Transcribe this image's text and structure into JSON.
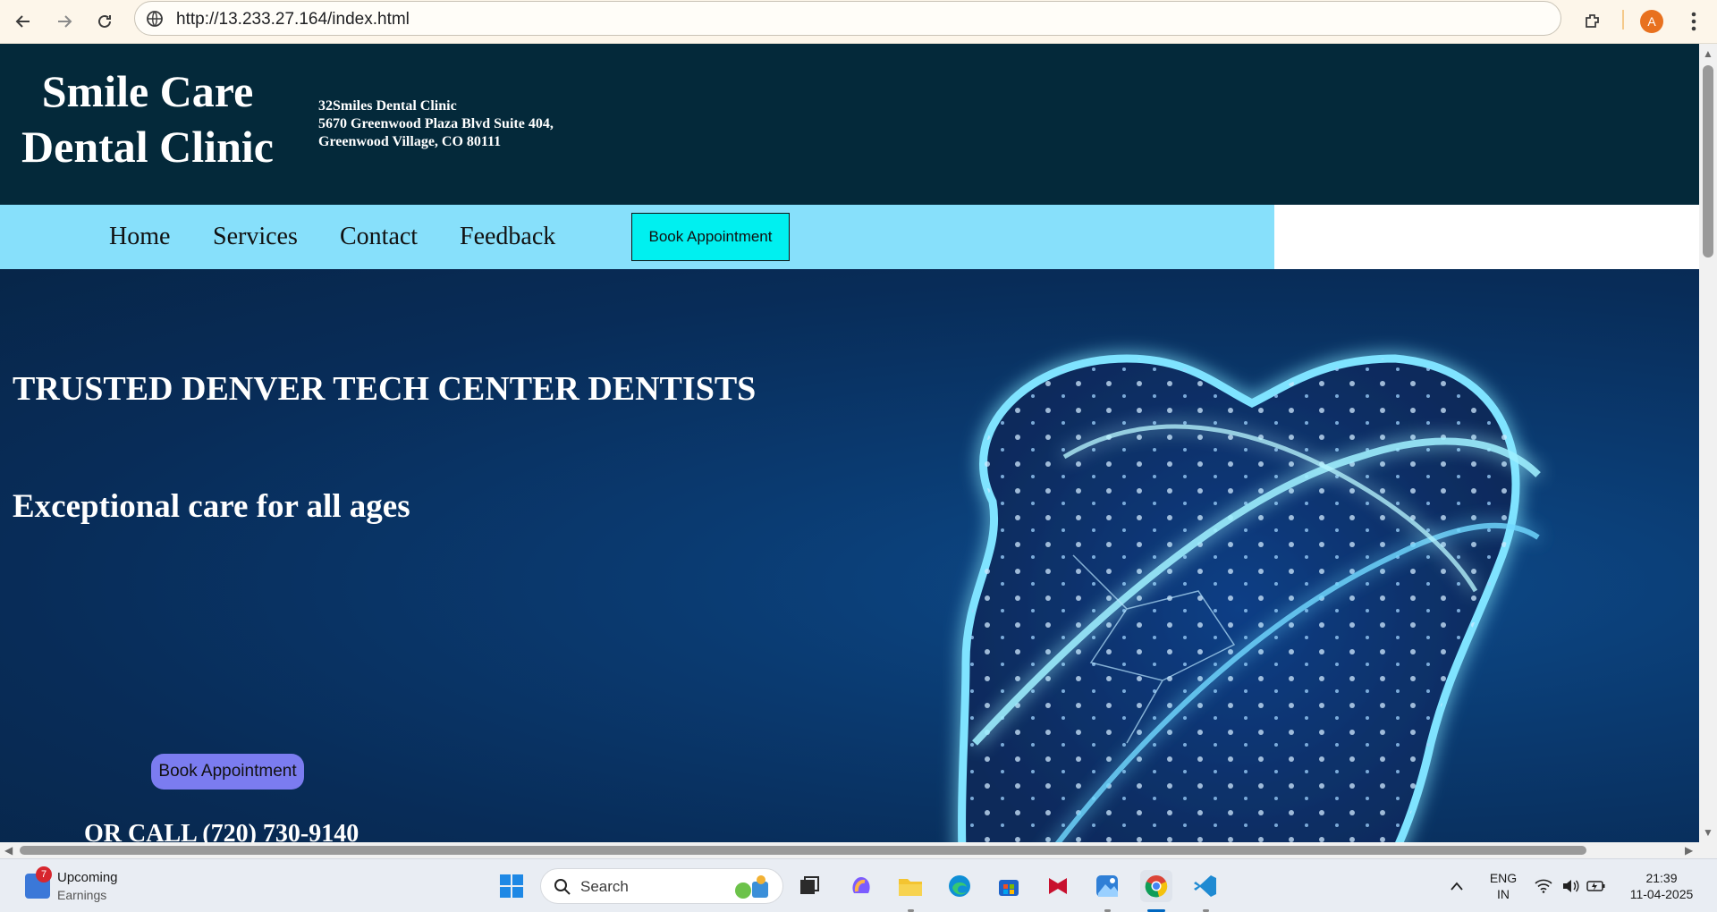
{
  "browser": {
    "url": "http://13.233.27.164/index.html",
    "profile_initial": "A",
    "icons": [
      "back-arrow-icon",
      "forward-arrow-icon",
      "reload-icon",
      "site-info-icon",
      "extensions-icon",
      "profile-avatar",
      "more-menu-icon"
    ]
  },
  "site": {
    "logo": "Smile Care Dental Clinic",
    "address": {
      "line1": "32Smiles Dental Clinic",
      "line2": "5670 Greenwood Plaza Blvd Suite 404,",
      "line3": "Greenwood Village, CO 80111"
    },
    "nav": {
      "items": [
        "Home",
        "Services",
        "Contact",
        "Feedback"
      ],
      "book_label": "Book Appointment"
    },
    "hero": {
      "title": "TRUSTED DENVER TECH CENTER DENTISTS",
      "subtitle": "Exceptional care for all ages",
      "book_label": "Book Appointment",
      "call_text": "OR CALL (720) 730-9140"
    },
    "colors": {
      "header_bg": "#04293a",
      "nav_bg": "#87e0fb",
      "nav_button_bg": "#00f0f0",
      "hero_button_bg": "#7b7cf0"
    }
  },
  "taskbar": {
    "widget_title": "Upcoming",
    "widget_subtitle": "Earnings",
    "widget_badge": "7",
    "search_placeholder": "Search",
    "language_line1": "ENG",
    "language_line2": "IN",
    "time": "21:39",
    "date": "11-04-2025",
    "apps": [
      "start-icon",
      "search-icon",
      "task-view-icon",
      "copilot-icon",
      "file-explorer-icon",
      "edge-icon",
      "store-icon",
      "mcafee-icon",
      "photos-icon",
      "chrome-icon",
      "vscode-icon"
    ]
  }
}
